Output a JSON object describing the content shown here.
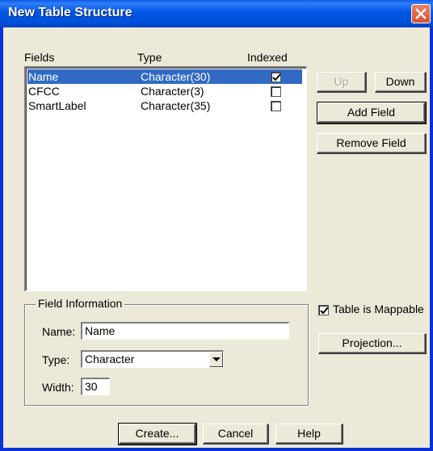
{
  "window": {
    "title": "New Table Structure"
  },
  "list": {
    "headers": {
      "fields": "Fields",
      "type": "Type",
      "indexed": "Indexed"
    },
    "rows": [
      {
        "name": "Name",
        "type": "Character(30)",
        "indexed": true,
        "selected": true
      },
      {
        "name": "CFCC",
        "type": "Character(3)",
        "indexed": false,
        "selected": false
      },
      {
        "name": "SmartLabel",
        "type": "Character(35)",
        "indexed": false,
        "selected": false
      }
    ]
  },
  "buttons": {
    "up": "Up",
    "down": "Down",
    "add_field": "Add Field",
    "remove_field": "Remove Field",
    "projection": "Projection...",
    "create": "Create...",
    "cancel": "Cancel",
    "help": "Help"
  },
  "field_info": {
    "group_title": "Field Information",
    "name_label": "Name:",
    "name_value": "Name",
    "type_label": "Type:",
    "type_value": "Character",
    "width_label": "Width:",
    "width_value": "30"
  },
  "mappable": {
    "label": "Table is Mappable",
    "checked": true
  },
  "colors": {
    "titlebar": "#0054e3",
    "selection": "#316ac5",
    "dialog_bg": "#ece9d8"
  }
}
